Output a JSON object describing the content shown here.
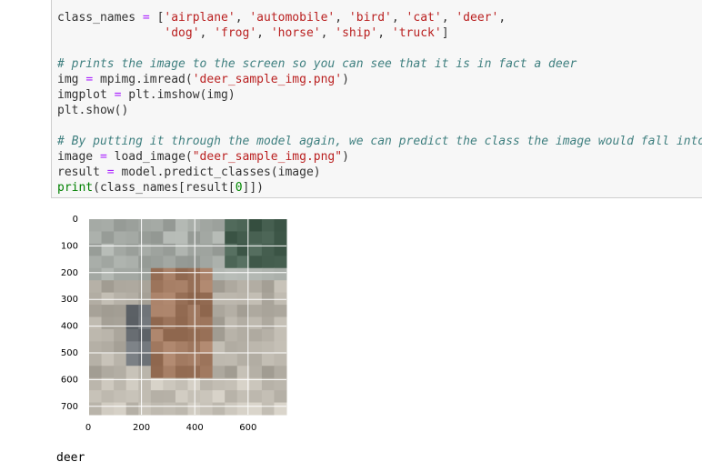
{
  "code_cell": {
    "lines": [
      {
        "parts": [
          [
            "",
            "class_names "
          ],
          [
            "op",
            "="
          ],
          [
            "",
            " ["
          ],
          [
            "str",
            "'airplane'"
          ],
          [
            "",
            ", "
          ],
          [
            "str",
            "'automobile'"
          ],
          [
            "",
            ", "
          ],
          [
            "str",
            "'bird'"
          ],
          [
            "",
            ", "
          ],
          [
            "str",
            "'cat'"
          ],
          [
            "",
            ", "
          ],
          [
            "str",
            "'deer'"
          ],
          [
            "",
            ","
          ]
        ]
      },
      {
        "parts": [
          [
            "",
            "               "
          ],
          [
            "str",
            "'dog'"
          ],
          [
            "",
            ", "
          ],
          [
            "str",
            "'frog'"
          ],
          [
            "",
            ", "
          ],
          [
            "str",
            "'horse'"
          ],
          [
            "",
            ", "
          ],
          [
            "str",
            "'ship'"
          ],
          [
            "",
            ", "
          ],
          [
            "str",
            "'truck'"
          ],
          [
            "",
            "]"
          ]
        ]
      },
      {
        "parts": []
      },
      {
        "parts": [
          [
            "cmt",
            "# prints the image to the screen so you can see that it is in fact a deer"
          ]
        ]
      },
      {
        "parts": [
          [
            "",
            "img "
          ],
          [
            "op",
            "="
          ],
          [
            "",
            " mpimg.imread("
          ],
          [
            "str",
            "'deer_sample_img.png'"
          ],
          [
            "",
            ")"
          ]
        ]
      },
      {
        "parts": [
          [
            "",
            "imgplot "
          ],
          [
            "op",
            "="
          ],
          [
            "",
            " plt.imshow(img)"
          ]
        ]
      },
      {
        "parts": [
          [
            "",
            "plt.show()"
          ]
        ]
      },
      {
        "parts": []
      },
      {
        "parts": [
          [
            "cmt",
            "# By putting it through the model again, we can predict the class the image would fall into"
          ]
        ]
      },
      {
        "parts": [
          [
            "",
            "image "
          ],
          [
            "op",
            "="
          ],
          [
            "",
            " load_image("
          ],
          [
            "str",
            "\"deer_sample_img.png\""
          ],
          [
            "",
            ")"
          ]
        ]
      },
      {
        "parts": [
          [
            "",
            "result "
          ],
          [
            "op",
            "="
          ],
          [
            "",
            " model.predict_classes(image)"
          ]
        ]
      },
      {
        "parts": [
          [
            "builtin",
            "print"
          ],
          [
            "",
            "(class_names[result["
          ],
          [
            "num",
            "0"
          ],
          [
            "",
            "]])"
          ]
        ]
      }
    ]
  },
  "plot": {
    "y_ticks": [
      "0",
      "100",
      "200",
      "300",
      "400",
      "500",
      "600",
      "700"
    ],
    "x_ticks": [
      "0",
      "200",
      "400",
      "600"
    ]
  },
  "output": {
    "text": "deer"
  }
}
